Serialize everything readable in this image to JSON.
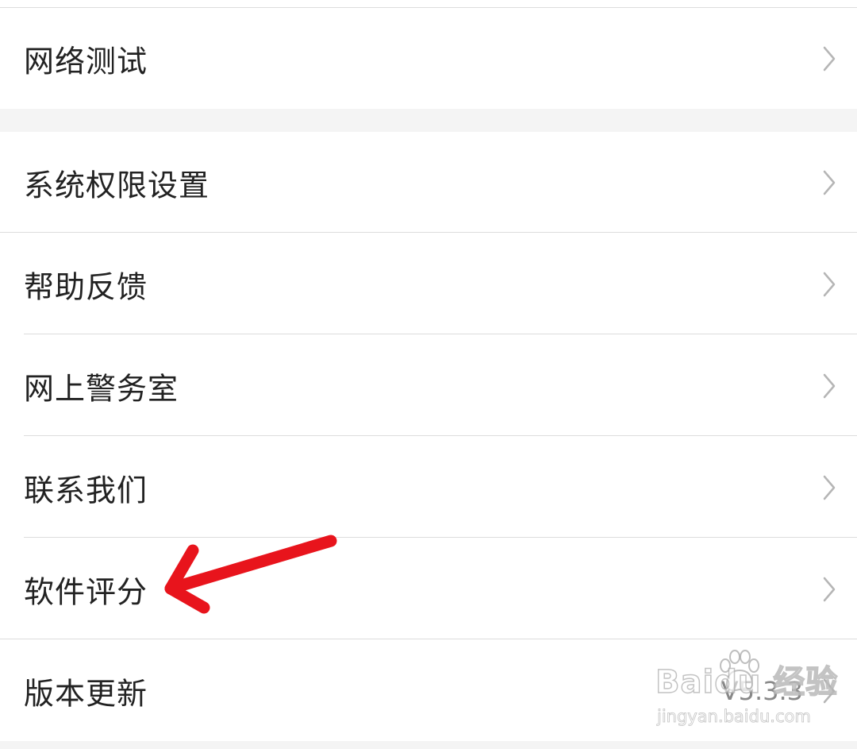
{
  "settings": {
    "network_test": "网络测试",
    "permissions": "系统权限设置",
    "help_feedback": "帮助反馈",
    "online_police": "网上警务室",
    "contact_us": "联系我们",
    "rate_app": "软件评分",
    "version_update": "版本更新",
    "version_value": "V5.3.3"
  },
  "watermark": {
    "logo": "Baidu 经验",
    "url": "jingyan.baidu.com"
  },
  "annotation": {
    "arrow_color": "#e8141c"
  },
  "colors": {
    "background": "#f4f4f4",
    "row": "#ffffff",
    "divider": "#dcdcdc",
    "text": "#222222",
    "chevron": "#b5b5b5"
  }
}
